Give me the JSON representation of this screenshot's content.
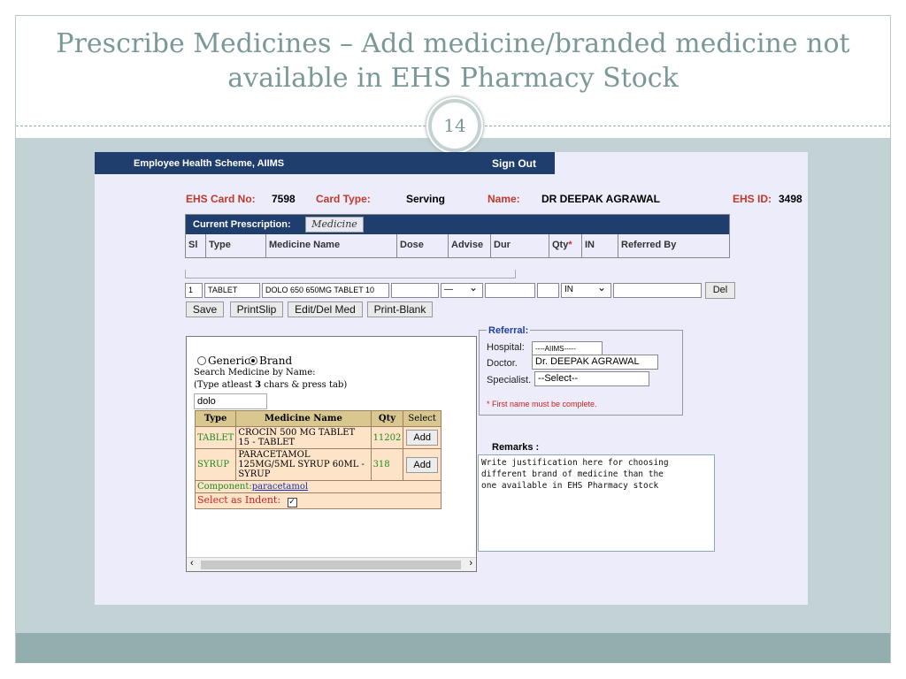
{
  "slide": {
    "title_line1": "Prescribe Medicines – Add medicine/branded medicine not",
    "title_line2": "available in EHS Pharmacy Stock",
    "page_number": "14"
  },
  "app": {
    "title": "Employee Health Scheme, AIIMS",
    "sign_out": "Sign Out"
  },
  "patient": {
    "card_no_label": "EHS Card No:",
    "card_no": "7598",
    "card_type_label": "Card Type:",
    "card_type": "Serving",
    "name_label": "Name:",
    "name": "DR DEEPAK AGRAWAL",
    "ehs_id_label": "EHS ID:",
    "ehs_id": "3498"
  },
  "prescription": {
    "heading": "Current Prescription:",
    "tab": "Medicine",
    "columns": [
      "Sl",
      "Type",
      "Medicine Name",
      "Dose",
      "Advise",
      "Dur",
      "Qty",
      "IN",
      "Referred By"
    ],
    "required_mark": "*",
    "row": {
      "sl": "1",
      "type": "TABLET",
      "medicine": "DOLO 650 650MG TABLET 10",
      "dose": "",
      "advise": "—",
      "dur": "",
      "qty": "",
      "in": "IN",
      "referred_by": "",
      "delete": "Del"
    }
  },
  "actions": [
    "Save",
    "PrintSlip",
    "Edit/Del Med",
    "Print-Blank"
  ],
  "search": {
    "generic_label": "Generic",
    "brand_label": "Brand",
    "selected": "Brand",
    "prompt": "Search  Medicine by Name:",
    "hint_pre": "(Type atleast ",
    "hint_num": "3",
    "hint_post": " chars & press tab)",
    "value": "dolo",
    "table_headers": [
      "Type",
      "Medicine Name",
      "Qty",
      "Select"
    ],
    "results": [
      {
        "type": "TABLET",
        "name": "CROCIN 500 MG TABLET 15 - TABLET",
        "qty": "11202",
        "action": "Add"
      },
      {
        "type": "SYRUP",
        "name": "PARACETAMOL 125MG/5ML SYRUP 60ML - SYRUP",
        "qty": "318",
        "action": "Add"
      }
    ],
    "component_label": "Component:",
    "component": "paracetamol",
    "indent_label": "Select as Indent:",
    "indent_checked": true
  },
  "referral": {
    "legend": "Referral:",
    "hospital_label": "Hospital:",
    "hospital": "----AIIMS-----",
    "doctor_label": "Doctor.",
    "doctor": "Dr. DEEPAK AGRAWAL",
    "specialist_label": "Specialist.",
    "specialist": "--Select--",
    "note": "* First name must be complete."
  },
  "remarks": {
    "label": "Remarks :",
    "text": "Write justification here for choosing\ndifferent brand of medicine than the\none available in EHS Pharmacy stock"
  }
}
